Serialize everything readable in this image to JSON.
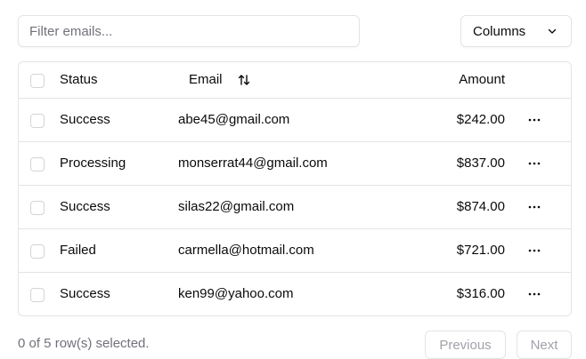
{
  "filter": {
    "placeholder": "Filter emails...",
    "value": ""
  },
  "columns_button": {
    "label": "Columns",
    "icon": "chevron-down-icon"
  },
  "table": {
    "headers": {
      "status": "Status",
      "email": "Email",
      "amount": "Amount",
      "sort_icon": "sort-arrows-icon"
    },
    "rows": [
      {
        "status": "Success",
        "email": "abe45@gmail.com",
        "amount": "$242.00"
      },
      {
        "status": "Processing",
        "email": "monserrat44@gmail.com",
        "amount": "$837.00"
      },
      {
        "status": "Success",
        "email": "silas22@gmail.com",
        "amount": "$874.00"
      },
      {
        "status": "Failed",
        "email": "carmella@hotmail.com",
        "amount": "$721.00"
      },
      {
        "status": "Success",
        "email": "ken99@yahoo.com",
        "amount": "$316.00"
      }
    ],
    "row_action_icon": "more-horizontal-icon"
  },
  "footer": {
    "selection_text": "0 of 5 row(s) selected.",
    "previous_label": "Previous",
    "next_label": "Next"
  },
  "colors": {
    "border": "#e4e4e7",
    "muted_text": "#71717a",
    "disabled_text": "#a1a1aa",
    "text": "#0a0a0a"
  }
}
